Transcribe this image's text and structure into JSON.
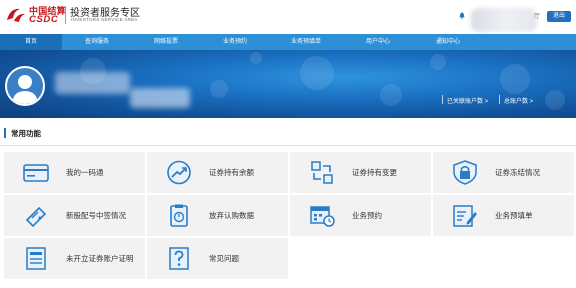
{
  "header": {
    "logo_cn": "中国结算",
    "logo_en": "CSDC",
    "zone_title": "投资者服务专区",
    "zone_sub": "INVESTORS SERVICE AREA",
    "user_tail": "厅",
    "logout_label": "退出"
  },
  "nav": {
    "items": [
      {
        "label": "首页",
        "active": true
      },
      {
        "label": "查询服务"
      },
      {
        "label": "网络投票"
      },
      {
        "label": "业务预约"
      },
      {
        "label": "业务预填单"
      },
      {
        "label": "用户中心"
      },
      {
        "label": "通知中心"
      }
    ]
  },
  "banner": {
    "linked_accounts": "已关联账户数 >",
    "total_accounts": "总账户数 >"
  },
  "section": {
    "title": "常用功能"
  },
  "functions": [
    {
      "label": "我的一码通",
      "icon": "card-icon"
    },
    {
      "label": "证券持有余额",
      "icon": "trend-chart-icon"
    },
    {
      "label": "证券持有变更",
      "icon": "swap-icon"
    },
    {
      "label": "证券冻结情况",
      "icon": "lock-shield-icon"
    },
    {
      "label": "新股配号中签情况",
      "icon": "ticket-icon"
    },
    {
      "label": "放弃认购数据",
      "icon": "clipboard-icon"
    },
    {
      "label": "业务预约",
      "icon": "calendar-clock-icon"
    },
    {
      "label": "业务预填单",
      "icon": "form-edit-icon"
    },
    {
      "label": "未开立证券账户证明",
      "icon": "certificate-icon"
    },
    {
      "label": "常见问题",
      "icon": "question-icon"
    }
  ],
  "colors": {
    "accent": "#1f71bd",
    "nav": "#2d8fd6",
    "brand_red": "#c8161d",
    "tile_bg": "#f2f2f2"
  }
}
